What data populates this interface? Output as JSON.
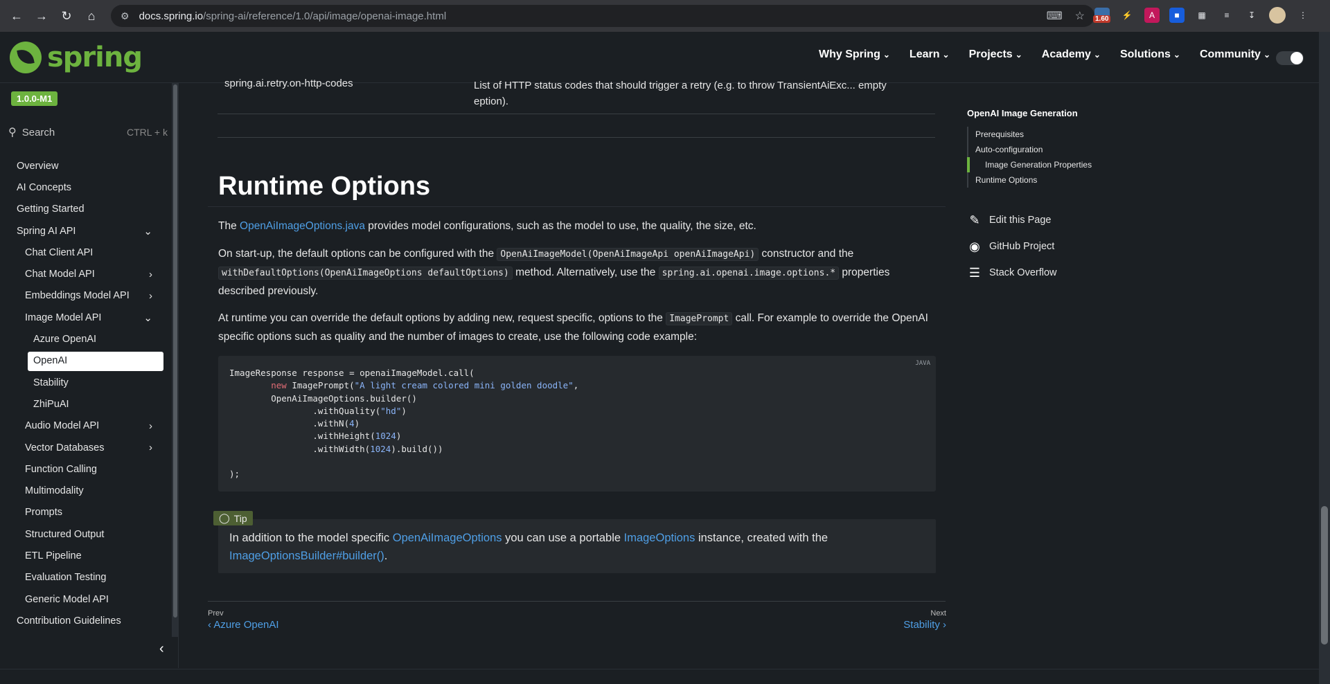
{
  "browser": {
    "url_host": "docs.spring.io",
    "url_path": "/spring-ai/reference/1.0/api/image/openai-image.html",
    "ext_badge": "1.60"
  },
  "header": {
    "logo_text": "spring",
    "nav": [
      {
        "label": "Why Spring"
      },
      {
        "label": "Learn"
      },
      {
        "label": "Projects"
      },
      {
        "label": "Academy"
      },
      {
        "label": "Solutions"
      },
      {
        "label": "Community"
      }
    ]
  },
  "sidebar": {
    "version": "1.0.0-M1",
    "search_label": "Search",
    "search_shortcut": "CTRL + k",
    "items": [
      {
        "label": "Overview"
      },
      {
        "label": "AI Concepts"
      },
      {
        "label": "Getting Started"
      },
      {
        "label": "Spring AI API"
      },
      {
        "label": "Chat Client API"
      },
      {
        "label": "Chat Model API"
      },
      {
        "label": "Embeddings Model API"
      },
      {
        "label": "Image Model API"
      },
      {
        "label": "Azure OpenAI"
      },
      {
        "label": "OpenAI"
      },
      {
        "label": "Stability"
      },
      {
        "label": "ZhiPuAI"
      },
      {
        "label": "Audio Model API"
      },
      {
        "label": "Vector Databases"
      },
      {
        "label": "Function Calling"
      },
      {
        "label": "Multimodality"
      },
      {
        "label": "Prompts"
      },
      {
        "label": "Structured Output"
      },
      {
        "label": "ETL Pipeline"
      },
      {
        "label": "Evaluation Testing"
      },
      {
        "label": "Generic Model API"
      },
      {
        "label": "Contribution Guidelines"
      }
    ]
  },
  "content": {
    "prop_name": "spring.ai.retry.on-http-codes",
    "prop_desc": "List of HTTP status codes that should trigger a retry (e.g. to throw TransientAiExc... empty eption).",
    "heading": "Runtime Options",
    "p1_link": "OpenAiImageOptions.java",
    "p1_text": " provides model configurations, such as the model to use, the quality, the size, etc.",
    "p1_pre": "The ",
    "p2_a": "On start-up, the default options can be configured with the ",
    "p2_code1": "OpenAiImageModel(OpenAiImageApi openAiImageApi)",
    "p2_b": " constructor and the ",
    "p2_code2": "withDefaultOptions(OpenAiImageOptions defaultOptions)",
    "p2_c": " method. Alternatively, use the ",
    "p2_code3": "spring.ai.openai.image.options.*",
    "p2_d": " properties described previously.",
    "p3_a": "At runtime you can override the default options by adding new, request specific, options to the ",
    "p3_code": "ImagePrompt",
    "p3_b": " call. For example to override the OpenAI specific options such as quality and the number of images to create, use the following code example:",
    "code_lang": "JAVA",
    "tip_label": "Tip",
    "tip_a": "In addition to the model specific ",
    "tip_link1": "OpenAiImageOptions",
    "tip_b": " you can use a portable ",
    "tip_link2": "ImageOptions",
    "tip_c": " instance, created with the ",
    "tip_link3": "ImageOptionsBuilder#builder()",
    "tip_d": ".",
    "prev_small": "Prev",
    "prev_link": "Azure OpenAI",
    "next_small": "Next",
    "next_link": "Stability"
  },
  "toc": {
    "title": "OpenAI Image Generation",
    "items": [
      {
        "label": "Prerequisites"
      },
      {
        "label": "Auto-configuration"
      },
      {
        "label": "Image Generation Properties"
      },
      {
        "label": "Runtime Options"
      }
    ],
    "links": [
      {
        "label": "Edit this Page",
        "icon": "pencil-icon"
      },
      {
        "label": "GitHub Project",
        "icon": "github-icon"
      },
      {
        "label": "Stack Overflow",
        "icon": "stackoverflow-icon"
      }
    ]
  }
}
